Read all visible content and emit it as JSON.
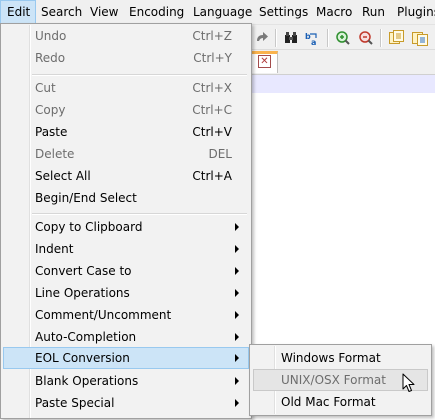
{
  "menubar": {
    "items": [
      {
        "label": "Edit"
      },
      {
        "label": "Search"
      },
      {
        "label": "View"
      },
      {
        "label": "Encoding"
      },
      {
        "label": "Language"
      },
      {
        "label": "Settings"
      },
      {
        "label": "Macro"
      },
      {
        "label": "Run"
      },
      {
        "label": "Plugins"
      }
    ]
  },
  "edit_menu": {
    "items": [
      {
        "label": "Undo",
        "shortcut": "Ctrl+Z",
        "state": "disabled"
      },
      {
        "label": "Redo",
        "shortcut": "Ctrl+Y",
        "state": "disabled"
      },
      {
        "label": "Cut",
        "shortcut": "Ctrl+X",
        "state": "disabled"
      },
      {
        "label": "Copy",
        "shortcut": "Ctrl+C",
        "state": "disabled"
      },
      {
        "label": "Paste",
        "shortcut": "Ctrl+V",
        "state": "enabled"
      },
      {
        "label": "Delete",
        "shortcut": "DEL",
        "state": "disabled"
      },
      {
        "label": "Select All",
        "shortcut": "Ctrl+A",
        "state": "enabled"
      },
      {
        "label": "Begin/End Select",
        "shortcut": "",
        "state": "enabled"
      },
      {
        "label": "Copy to Clipboard",
        "submenu": true
      },
      {
        "label": "Indent",
        "submenu": true
      },
      {
        "label": "Convert Case to",
        "submenu": true
      },
      {
        "label": "Line Operations",
        "submenu": true
      },
      {
        "label": "Comment/Uncomment",
        "submenu": true
      },
      {
        "label": "Auto-Completion",
        "submenu": true
      },
      {
        "label": "EOL Conversion",
        "submenu": true,
        "state": "highlighted"
      },
      {
        "label": "Blank Operations",
        "submenu": true
      },
      {
        "label": "Paste Special",
        "submenu": true
      }
    ]
  },
  "eol_submenu": {
    "items": [
      {
        "label": "Windows Format",
        "state": "enabled"
      },
      {
        "label": "UNIX/OSX Format",
        "state": "disabled-hover"
      },
      {
        "label": "Old Mac Format",
        "state": "enabled"
      }
    ]
  },
  "tab": {
    "close_glyph": "✕"
  },
  "colors": {
    "menu_highlight": "#cce4f7",
    "menu_highlight_border": "#99c9ef",
    "tab_accent": "#fab34d",
    "caret_line": "#e8e8ff"
  },
  "icons": [
    "redo-icon",
    "find-icon",
    "replace-icon",
    "zoom-in-icon",
    "zoom-out-icon",
    "sync-v-icon",
    "sync-h-icon",
    "close-tab-icon",
    "mouse-pointer-icon"
  ]
}
